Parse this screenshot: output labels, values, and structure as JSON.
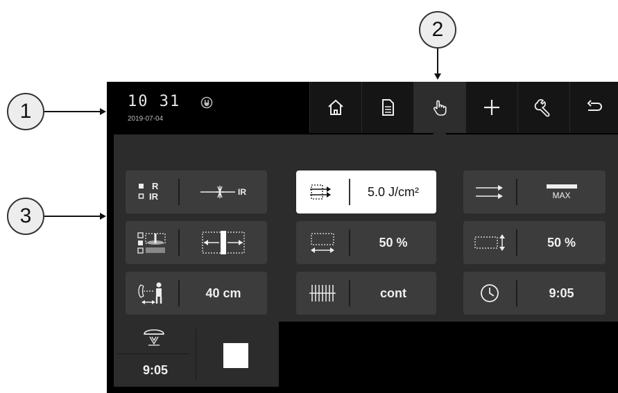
{
  "callouts": [
    "1",
    "2",
    "3"
  ],
  "status": {
    "time": "10 31",
    "date": "2019-07-04",
    "power_icon": "plug-icon"
  },
  "nav": [
    {
      "icon": "home-icon"
    },
    {
      "icon": "document-icon"
    },
    {
      "icon": "hand-icon",
      "active": true
    },
    {
      "icon": "plus-icon"
    },
    {
      "icon": "wrench-icon"
    },
    {
      "icon": "back-arrow-icon"
    }
  ],
  "tiles": {
    "mode": {
      "icon_label_r": "R",
      "icon_label_ir": "IR",
      "value_label": "IR"
    },
    "energy": {
      "value": "5.0 J/cm²"
    },
    "power": {
      "value_label": "MAX"
    },
    "field_width": {
      "value": "50 %"
    },
    "field_height": {
      "value": "50 %"
    },
    "distance": {
      "value": "40 cm"
    },
    "pulse": {
      "value": "cont"
    },
    "timer": {
      "value": "9:05"
    },
    "lamp": {
      "value": "9:05"
    }
  },
  "colors": {
    "screen": "#000000",
    "panel": "#2c2c2c",
    "tile": "#3c3c3c",
    "highlight": "#ffffff"
  }
}
